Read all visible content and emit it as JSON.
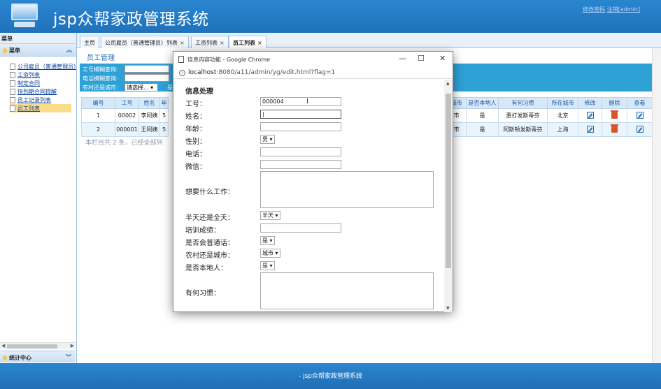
{
  "header": {
    "title": "jsp众帮家政管理系统",
    "link_change_password": "修改密码",
    "link_logout": "注销[admin]"
  },
  "sidebar": {
    "head": "菜单",
    "group_label": "菜单",
    "items": [
      {
        "label": "公司雇员（普通管理员）"
      },
      {
        "label": "工资列表"
      },
      {
        "label": "制定合同"
      },
      {
        "label": "快到期合同提醒"
      },
      {
        "label": "员工记录列表"
      },
      {
        "label": "员工列表"
      }
    ],
    "bottom_group": "统计中心"
  },
  "tabs": [
    {
      "label": "主页"
    },
    {
      "label": "公司雇员（普通管理员）列表"
    },
    {
      "label": "工资列表"
    },
    {
      "label": "员工列表"
    }
  ],
  "content": {
    "page_title": "员工管理",
    "search": {
      "label_id": "工号模糊查询:",
      "label_phone": "电话模糊查询:",
      "label_city": "农村还是城市:",
      "select_city": "请选择...",
      "extra": "是"
    },
    "columns_left": [
      "编号",
      "工号",
      "姓名",
      "年"
    ],
    "columns_right": [
      "城市",
      "是否本地人",
      "有何习惯",
      "所在城市",
      "修改",
      "删除",
      "查看"
    ],
    "rows": [
      {
        "index": "1",
        "id": "00002",
        "name": "李阿姨",
        "age": "5",
        "city_or_rural": "市",
        "local": "是",
        "habit": "惠打发斯蒂芬",
        "city": "北京"
      },
      {
        "index": "2",
        "id": "000001",
        "name": "王阿姨",
        "age": "5",
        "city_or_rural": "市",
        "local": "是",
        "habit": "阿斯顿发斯蒂芬",
        "city": "上海"
      }
    ],
    "summary": "本栏目共 2 条，已经全部列"
  },
  "footer": {
    "text": "- jsp众帮家政管理系统"
  },
  "popup": {
    "window_title": "信息内容功能 - Google Chrome",
    "url_host": "localhost",
    "url_rest": ":8080/a11/admin/yg/edit.html?flag=1",
    "heading": "信息处理",
    "labels": {
      "id": "工号：",
      "name": "姓名：",
      "age": "年龄：",
      "gender": "性别：",
      "phone": "电话：",
      "wechat": "微信：",
      "job": "想要什么工作：",
      "half_full": "半天还是全天：",
      "training": "培训成绩：",
      "mandarin": "是否会普通话：",
      "city_rural": "农村还是城市：",
      "local": "是否本地人：",
      "habit": "有何习惯："
    },
    "values": {
      "id": "000004",
      "gender": "男",
      "half_full": "半天",
      "mandarin": "是",
      "city_rural": "城市",
      "local": "是"
    }
  }
}
